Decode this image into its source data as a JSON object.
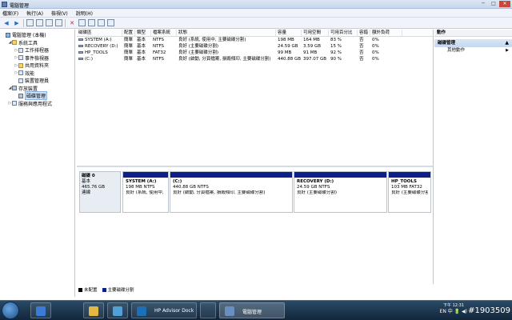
{
  "window": {
    "title": "電腦管理"
  },
  "menu": [
    "檔案(F)",
    "執行(A)",
    "檢視(V)",
    "說明(H)"
  ],
  "tree": [
    {
      "label": "電腦管理 (本機)",
      "indent": 0,
      "exp": "",
      "icon": "comp"
    },
    {
      "label": "系統工具",
      "indent": 1,
      "exp": "◢",
      "icon": "folder"
    },
    {
      "label": "工作排程器",
      "indent": 2,
      "exp": "▷",
      "icon": "box"
    },
    {
      "label": "事件檢視器",
      "indent": 2,
      "exp": "▷",
      "icon": "box"
    },
    {
      "label": "共用資料夾",
      "indent": 2,
      "exp": "▷",
      "icon": "folder"
    },
    {
      "label": "效能",
      "indent": 2,
      "exp": "▷",
      "icon": "box"
    },
    {
      "label": "裝置管理員",
      "indent": 2,
      "exp": "",
      "icon": "box"
    },
    {
      "label": "存放裝置",
      "indent": 1,
      "exp": "◢",
      "icon": "disk"
    },
    {
      "label": "磁碟管理",
      "indent": 2,
      "exp": "",
      "icon": "disk",
      "selected": true
    },
    {
      "label": "服務與應用程式",
      "indent": 1,
      "exp": "▷",
      "icon": "box"
    }
  ],
  "list": {
    "headers": [
      "磁碟區",
      "配置",
      "類型",
      "檔案系統",
      "狀態",
      "容量",
      "可用空間",
      "可用百分比",
      "容錯",
      "額外負荷"
    ],
    "rows": [
      [
        "SYSTEM (A:)",
        "簡單",
        "基本",
        "NTFS",
        "良好 (系統, 使用中, 主要磁碟分割)",
        "198 MB",
        "164 MB",
        "83 %",
        "否",
        "0%"
      ],
      [
        "RECOVERY (D:)",
        "簡單",
        "基本",
        "NTFS",
        "良好 (主要磁碟分割)",
        "24.59 GB",
        "3.59 GB",
        "15 %",
        "否",
        "0%"
      ],
      [
        "HP_TOOLS",
        "簡單",
        "基本",
        "FAT32",
        "良好 (主要磁碟分割)",
        "99 MB",
        "91 MB",
        "92 %",
        "否",
        "0%"
      ],
      [
        "(C:)",
        "簡單",
        "基本",
        "NTFS",
        "良好 (啟動, 分頁檔案, 損毀傾印, 主要磁碟分割)",
        "440.88 GB",
        "397.07 GB",
        "90 %",
        "否",
        "0%"
      ]
    ]
  },
  "disk": {
    "name": "磁碟 0",
    "type": "基本",
    "size": "465.76 GB",
    "status": "連線",
    "partitions": [
      {
        "name": "SYSTEM (A:)",
        "size": "198 MB NTFS",
        "status": "良好 (系統, 使用中, 主"
      },
      {
        "name": "(C:)",
        "size": "440.88 GB NTFS",
        "status": "良好 (啟動, 分頁檔案, 損毀傾印, 主要磁碟分割)"
      },
      {
        "name": "RECOVERY (D:)",
        "size": "24.59 GB NTFS",
        "status": "良好 (主要磁碟分割)"
      },
      {
        "name": "HP_TOOLS",
        "size": "103 MB FAT32",
        "status": "良好 (主要磁碟分割)"
      }
    ]
  },
  "legend": [
    {
      "label": "未配置",
      "color": "#000000"
    },
    {
      "label": "主要磁碟分割",
      "color": "#0f1f8a"
    }
  ],
  "actions": {
    "header": "動作",
    "section": "磁碟管理",
    "items": [
      "其他動作"
    ]
  },
  "taskbar": {
    "apps": [
      {
        "label": "",
        "color": "#3a7bd5"
      },
      {
        "label": "",
        "color": "#e2b844"
      },
      {
        "label": "",
        "color": "#4fa1d8"
      },
      {
        "label": "HP Advisor Dock",
        "color": "#1d6fb8"
      },
      {
        "label": "",
        "color": "#8a8f96"
      },
      {
        "label": "電腦管理",
        "color": "#6a8fbf"
      }
    ],
    "tray": "EN 中 🔋 ◀)",
    "clock": "下午 12:31",
    "watermark": "#1903509"
  }
}
